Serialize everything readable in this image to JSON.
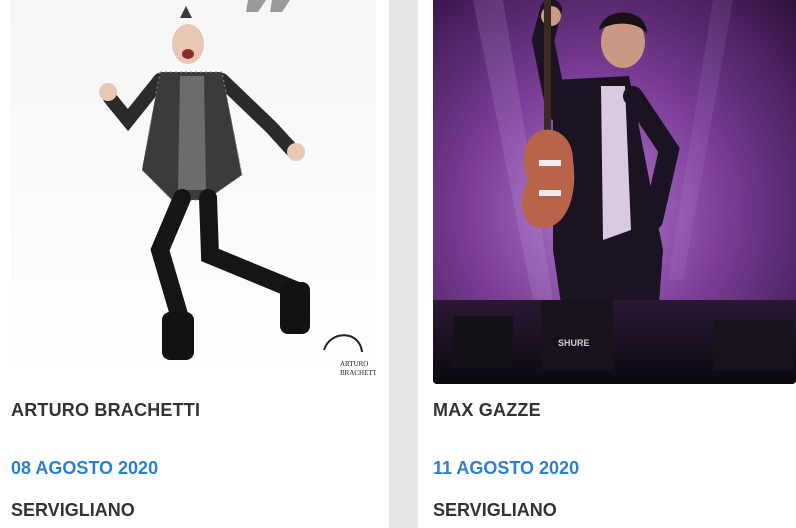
{
  "events": [
    {
      "title": "ARTURO BRACHETTI",
      "date": "08 AGOSTO 2020",
      "place": "SERVIGLIANO",
      "logo_text": "ARTURO BRACHETTI"
    },
    {
      "title": "MAX GAZZE",
      "date": "11 AGOSTO 2020",
      "place": "SERVIGLIANO",
      "amp_brand": "SHURE"
    }
  ],
  "colors": {
    "date_blue": "#2b7fd4",
    "title_dark": "#333333",
    "stage_purple": "#7a3c96"
  }
}
